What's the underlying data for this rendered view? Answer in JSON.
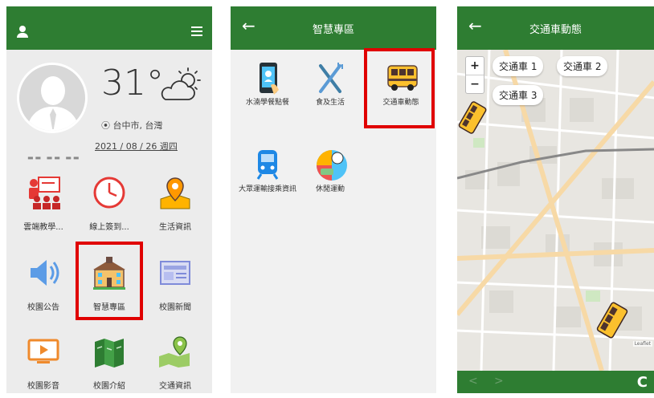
{
  "panel1": {
    "weather": {
      "temperature": "31°",
      "location": "台中市, 台灣",
      "date": "2021 / 08 / 26 週四"
    },
    "tiles": [
      {
        "label": "雲端教學...",
        "icon": "classroom-icon"
      },
      {
        "label": "線上簽到...",
        "icon": "clock-icon"
      },
      {
        "label": "生活資訊",
        "icon": "map-pin-icon"
      },
      {
        "label": "校園公告",
        "icon": "speaker-icon"
      },
      {
        "label": "智慧專區",
        "icon": "school-building-icon"
      },
      {
        "label": "校園新聞",
        "icon": "newspaper-icon"
      },
      {
        "label": "校園影音",
        "icon": "video-icon"
      },
      {
        "label": "校園介紹",
        "icon": "brochure-icon"
      },
      {
        "label": "交通資訊",
        "icon": "map-location-icon"
      }
    ]
  },
  "panel2": {
    "title": "智慧專區",
    "tiles": [
      {
        "label": "水湳學餐點餐",
        "icon": "phone-order-icon"
      },
      {
        "label": "食及生活",
        "icon": "fork-knife-icon"
      },
      {
        "label": "交通車動態",
        "icon": "school-bus-icon"
      },
      {
        "label": "大眾運輸接乘資訊",
        "icon": "metro-icon"
      },
      {
        "label": "休閒運動",
        "icon": "sports-ball-icon"
      }
    ]
  },
  "panel3": {
    "title": "交通車動態",
    "buses": [
      "交通車 1",
      "交通車 2",
      "交通車 3"
    ],
    "zoom_in": "+",
    "zoom_out": "−",
    "attribution": "Leaflet"
  },
  "colors": {
    "header_green": "#2e7d32",
    "highlight_red": "#e00000"
  }
}
